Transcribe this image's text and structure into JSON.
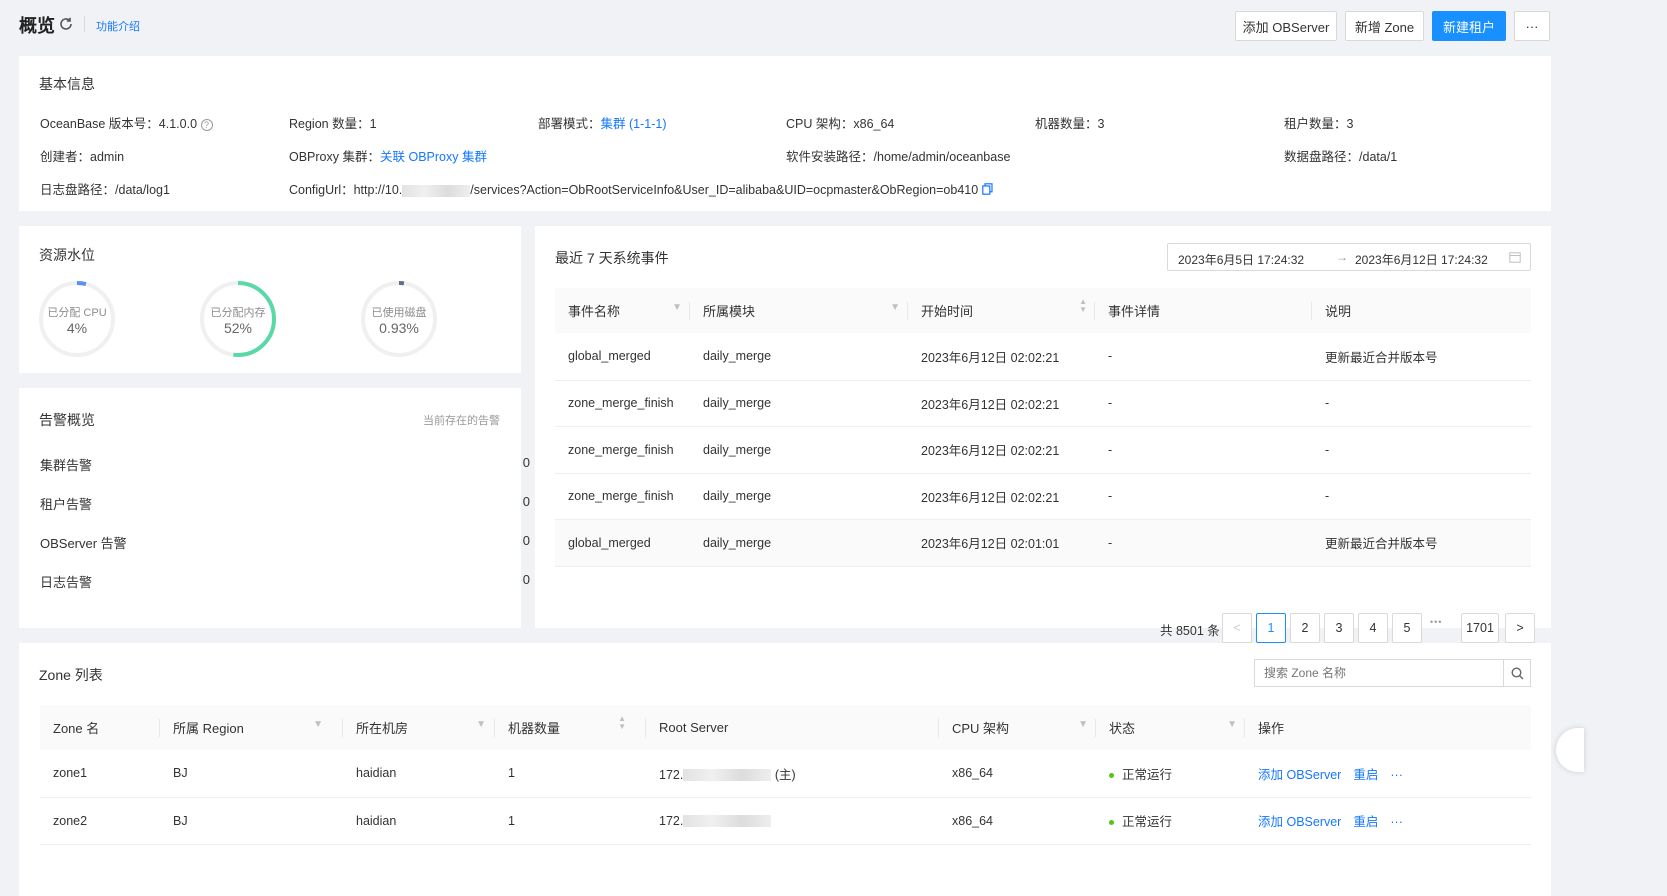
{
  "header": {
    "title": "概览",
    "intro_link": "功能介绍",
    "add_observer": "添加 OBServer",
    "add_zone": "新增 Zone",
    "new_tenant": "新建租户",
    "more": "···"
  },
  "basic": {
    "title": "基本信息",
    "version_label": "OceanBase 版本号：",
    "version": "4.1.0.0",
    "region_label": "Region 数量：",
    "region": "1",
    "deploy_label": "部署模式：",
    "deploy": "集群 (1-1-1)",
    "cpu_label": "CPU 架构：",
    "cpu": "x86_64",
    "machines_label": "机器数量：",
    "machines": "3",
    "tenants_label": "租户数量：",
    "tenants": "3",
    "creator_label": "创建者：",
    "creator": "admin",
    "obproxy_label": "OBProxy 集群：",
    "obproxy": "关联 OBProxy 集群",
    "install_label": "软件安装路径：",
    "install": "/home/admin/oceanbase",
    "datadisk_label": "数据盘路径：",
    "datadisk": "/data/1",
    "logdisk_label": "日志盘路径：",
    "logdisk": "/data/log1",
    "configurl_label": "ConfigUrl：",
    "configurl_prefix": "http://10.",
    "configurl_suffix": "/services?Action=ObRootServiceInfo&User_ID=alibaba&UID=ocpmaster&ObRegion=ob410"
  },
  "resources": {
    "title": "资源水位",
    "gauges": [
      {
        "label": "已分配 CPU",
        "value": "4%",
        "pct": 4,
        "color": "#5b8ff9"
      },
      {
        "label": "已分配内存",
        "value": "52%",
        "pct": 52,
        "color": "#5ad8a6"
      },
      {
        "label": "已使用磁盘",
        "value": "0.93%",
        "pct": 0.93,
        "color": "#5d7092"
      }
    ]
  },
  "alerts": {
    "title": "告警概览",
    "hint": "当前存在的告警",
    "items": [
      {
        "label": "集群告警",
        "count": "0"
      },
      {
        "label": "租户告警",
        "count": "0"
      },
      {
        "label": "OBServer 告警",
        "count": "0"
      },
      {
        "label": "日志告警",
        "count": "0"
      }
    ]
  },
  "events": {
    "title": "最近 7 天系统事件",
    "date_from": "2023年6月5日 17:24:32",
    "date_to": "2023年6月12日 17:24:32",
    "arrow": "→",
    "columns": [
      "事件名称",
      "所属模块",
      "开始时间",
      "事件详情",
      "说明"
    ],
    "rows": [
      [
        "global_merged",
        "daily_merge",
        "2023年6月12日 02:02:21",
        "-",
        "更新最近合并版本号"
      ],
      [
        "zone_merge_finish",
        "daily_merge",
        "2023年6月12日 02:02:21",
        "-",
        "-"
      ],
      [
        "zone_merge_finish",
        "daily_merge",
        "2023年6月12日 02:02:21",
        "-",
        "-"
      ],
      [
        "zone_merge_finish",
        "daily_merge",
        "2023年6月12日 02:02:21",
        "-",
        "-"
      ],
      [
        "global_merged",
        "daily_merge",
        "2023年6月12日 02:01:01",
        "-",
        "更新最近合并版本号"
      ]
    ],
    "pagination": {
      "total": "共 8501 条",
      "prev": "<",
      "pages": [
        "1",
        "2",
        "3",
        "4",
        "5"
      ],
      "ellipsis": "•••",
      "last": "1701",
      "next": ">"
    }
  },
  "zones": {
    "title": "Zone 列表",
    "search_placeholder": "搜索 Zone 名称",
    "columns": [
      "Zone 名",
      "所属 Region",
      "所在机房",
      "机器数量",
      "Root Server",
      "CPU 架构",
      "状态",
      "操作"
    ],
    "rows": [
      {
        "name": "zone1",
        "region": "BJ",
        "idc": "haidian",
        "machines": "1",
        "root_prefix": "172.",
        "root_suffix": "(主)",
        "cpu": "x86_64",
        "status": "正常运行",
        "op_add": "添加 OBServer",
        "op_restart": "重启",
        "op_more": "···"
      },
      {
        "name": "zone2",
        "region": "BJ",
        "idc": "haidian",
        "machines": "1",
        "root_prefix": "172.",
        "root_suffix": "",
        "cpu": "x86_64",
        "status": "正常运行",
        "op_add": "添加 OBServer",
        "op_restart": "重启",
        "op_more": "···"
      }
    ]
  }
}
